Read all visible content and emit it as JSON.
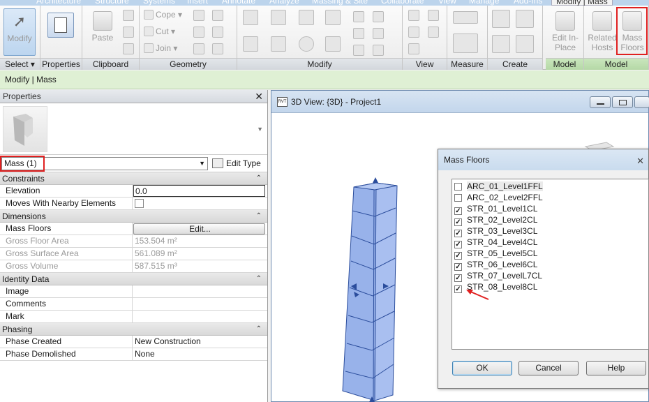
{
  "ribbon": {
    "tabs": [
      "Architecture",
      "Structure",
      "Systems",
      "Insert",
      "Annotate",
      "Analyze",
      "Massing & Site",
      "Collaborate",
      "View",
      "Manage",
      "Add-Ins",
      "Modify | Mass"
    ],
    "panels": {
      "select": "Select ▾",
      "properties": "Properties",
      "clipboard": "Clipboard",
      "geometry": "Geometry",
      "modify": "Modify",
      "view": "View",
      "measure": "Measure",
      "create": "Create",
      "model": "Model",
      "model2": "Model"
    },
    "buttons": {
      "modify": "Modify",
      "paste": "Paste",
      "cope": "Cope",
      "cut": "Cut",
      "join": "Join",
      "edit_in_place": "Edit In-Place",
      "related_hosts": "Related Hosts",
      "mass_floors": "Mass Floors"
    }
  },
  "context_bar": "Modify | Mass",
  "properties": {
    "title": "Properties",
    "type_selector": "Mass (1)",
    "edit_type": "Edit Type",
    "groups": {
      "constraints": "Constraints",
      "dimensions": "Dimensions",
      "identity": "Identity Data",
      "phasing": "Phasing"
    },
    "rows": {
      "elevation_k": "Elevation",
      "elevation_v": "0.0",
      "moves_k": "Moves With Nearby Elements",
      "mass_floors_k": "Mass Floors",
      "mass_floors_v": "Edit...",
      "gfa_k": "Gross Floor Area",
      "gfa_v": "153.504 m²",
      "gsa_k": "Gross Surface Area",
      "gsa_v": "561.089 m²",
      "gv_k": "Gross Volume",
      "gv_v": "587.515 m³",
      "image_k": "Image",
      "comments_k": "Comments",
      "mark_k": "Mark",
      "phase_created_k": "Phase Created",
      "phase_created_v": "New Construction",
      "phase_demolished_k": "Phase Demolished",
      "phase_demolished_v": "None"
    },
    "moves_checked": false
  },
  "view": {
    "title": "3D View: {3D} - Project1",
    "icon_text": "RVT"
  },
  "dialog": {
    "title": "Mass Floors",
    "levels": [
      {
        "label": "ARC_01_Level1FFL",
        "checked": false
      },
      {
        "label": "ARC_02_Level2FFL",
        "checked": false
      },
      {
        "label": "STR_01_Level1CL",
        "checked": true
      },
      {
        "label": "STR_02_Level2CL",
        "checked": true
      },
      {
        "label": "STR_03_Level3CL",
        "checked": true
      },
      {
        "label": "STR_04_Level4CL",
        "checked": true
      },
      {
        "label": "STR_05_Level5CL",
        "checked": true
      },
      {
        "label": "STR_06_Level6CL",
        "checked": true
      },
      {
        "label": "STR_07_LevelL7CL",
        "checked": true
      },
      {
        "label": "STR_08_Level8CL",
        "checked": true
      }
    ],
    "ok": "OK",
    "cancel": "Cancel",
    "help": "Help"
  },
  "colors": {
    "highlight": "#e02020",
    "mass_fill": "#9db4ec",
    "mass_edge": "#2b4d9c",
    "context_bar": "#dff0d4"
  }
}
